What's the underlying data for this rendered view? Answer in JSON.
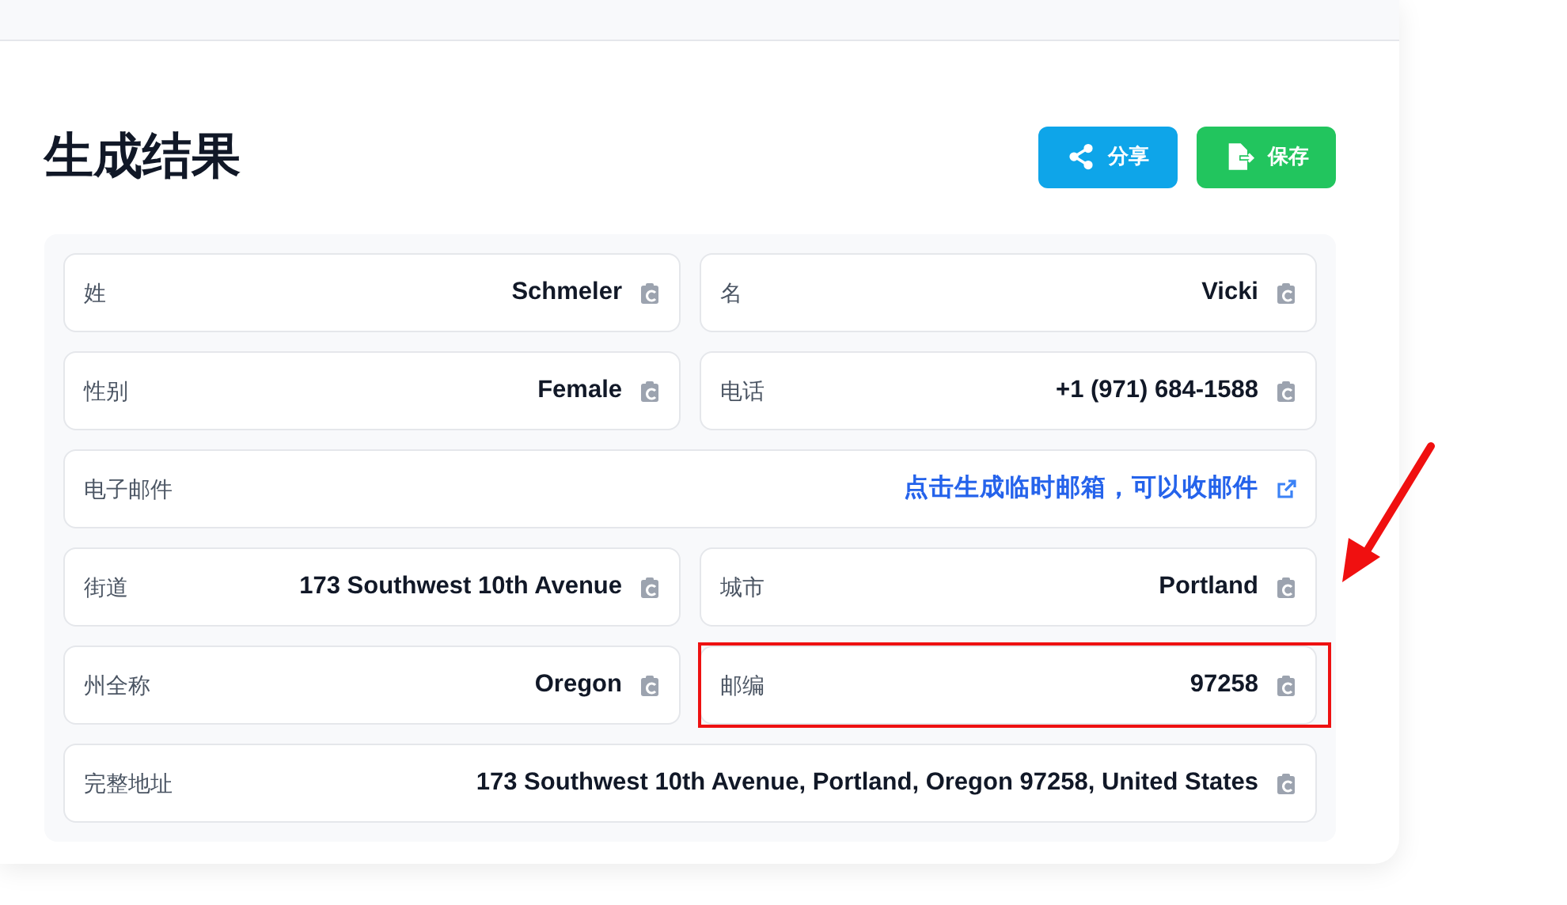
{
  "title": "生成结果",
  "buttons": [
    {
      "kind": "share",
      "label": "分享"
    },
    {
      "kind": "save",
      "label": "保存"
    }
  ],
  "fields": [
    {
      "label": "姓",
      "value": "Schmeler",
      "kind": "copy",
      "wide": false,
      "highlighted": false
    },
    {
      "label": "名",
      "value": "Vicki",
      "kind": "copy",
      "wide": false,
      "highlighted": false
    },
    {
      "label": "性别",
      "value": "Female",
      "kind": "copy",
      "wide": false,
      "highlighted": false
    },
    {
      "label": "电话",
      "value": "+1 (971) 684-1588",
      "kind": "copy",
      "wide": false,
      "highlighted": false
    },
    {
      "label": "电子邮件",
      "value": "点击生成临时邮箱，可以收邮件",
      "kind": "link",
      "wide": true,
      "highlighted": false
    },
    {
      "label": "街道",
      "value": "173 Southwest 10th Avenue",
      "kind": "copy",
      "wide": false,
      "highlighted": false
    },
    {
      "label": "城市",
      "value": "Portland",
      "kind": "copy",
      "wide": false,
      "highlighted": false
    },
    {
      "label": "州全称",
      "value": "Oregon",
      "kind": "copy",
      "wide": false,
      "highlighted": false
    },
    {
      "label": "邮编",
      "value": "97258",
      "kind": "copy",
      "wide": false,
      "highlighted": true
    },
    {
      "label": "完整地址",
      "value": "173 Southwest 10th Avenue, Portland, Oregon 97258, United States",
      "kind": "copy",
      "wide": true,
      "highlighted": false
    }
  ]
}
